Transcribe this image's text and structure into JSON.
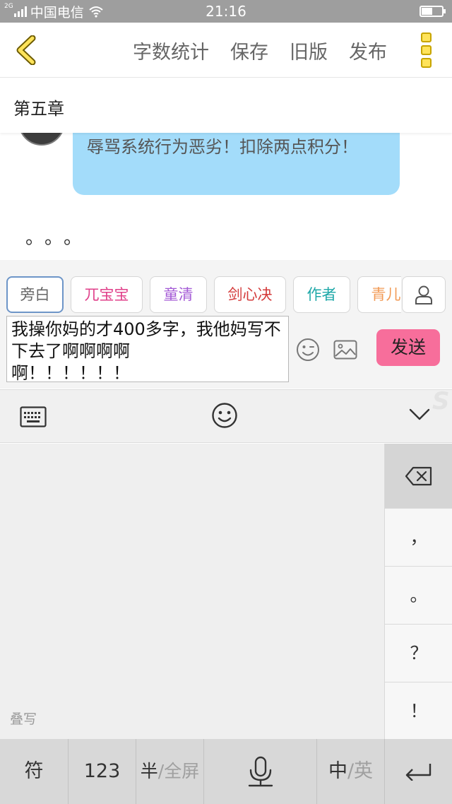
{
  "status_bar": {
    "network_type": "2G",
    "carrier": "中国电信",
    "time": "21:16",
    "battery_level": 0.55
  },
  "header": {
    "back_icon": "chevron-left-icon",
    "actions": [
      "字数统计",
      "保存",
      "旧版",
      "发布"
    ],
    "more_icon": "more-vertical-icon",
    "accent_color": "#ffe35a"
  },
  "chapter": {
    "title": "第五章"
  },
  "chat": {
    "bubble_text": "辱骂系统行为恶劣！扣除两点积分！",
    "bubble_color": "#a3dcfa",
    "ellipsis": "。。。"
  },
  "roles": [
    {
      "name": "旁白",
      "color": "#666666",
      "active": true
    },
    {
      "name": "兀宝宝",
      "color": "#e0408a",
      "active": false
    },
    {
      "name": "童清",
      "color": "#a45bd6",
      "active": false
    },
    {
      "name": "剑心决",
      "color": "#d43b3b",
      "active": false
    },
    {
      "name": "作者",
      "color": "#1ea8a8",
      "active": false
    },
    {
      "name": "青儿",
      "color": "#f29a55",
      "active": false
    }
  ],
  "composer": {
    "message": "我操你妈的才400多字，我他妈写不下去了啊啊啊啊\n啊！！！！！！",
    "send_label": "发送",
    "send_color": "#f76e9b"
  },
  "keyboard": {
    "handwrite_label": "叠写",
    "punctuation": [
      "，",
      "。",
      "？",
      "！"
    ],
    "bottom": {
      "symbols": "符",
      "numbers": "123",
      "half": "半",
      "full": "/全屏",
      "lang_cn": "中",
      "lang_en": "/英"
    },
    "logo": "S"
  }
}
